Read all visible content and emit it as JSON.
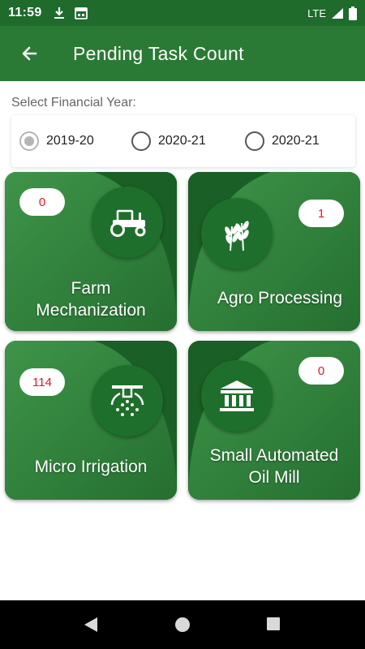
{
  "status_bar": {
    "time": "11:59",
    "network": "LTE",
    "icons": [
      "download-icon",
      "calendar-icon",
      "signal-icon",
      "battery-icon"
    ]
  },
  "app_bar": {
    "title": "Pending Task Count",
    "back_icon": "arrow-left-icon"
  },
  "financial_year": {
    "label": "Select Financial Year:",
    "options": [
      {
        "label": "2019-20",
        "checked": true
      },
      {
        "label": "2020-21",
        "checked": false
      },
      {
        "label": "2020-21",
        "checked": false
      }
    ]
  },
  "tiles": [
    {
      "title_line1": "Farm",
      "title_line2": "Mechanization",
      "count": "0",
      "icon": "tractor-icon"
    },
    {
      "title_line1": "Agro Processing",
      "title_line2": "",
      "count": "1",
      "icon": "wheat-icon"
    },
    {
      "title_line1": "Micro Irrigation",
      "title_line2": "",
      "count": "114",
      "icon": "sprinkler-icon"
    },
    {
      "title_line1": "Small Automated",
      "title_line2": "Oil Mill",
      "count": "0",
      "icon": "building-icon"
    }
  ],
  "colors": {
    "primary": "#2a7a35",
    "status_bar": "#1e6b2b",
    "tile_dark": "#1e6b2b",
    "tile_light": "#3a8f45",
    "badge_text": "#e21b1b"
  },
  "nav_bar": {
    "icons": [
      "back-triangle-icon",
      "home-circle-icon",
      "recents-square-icon"
    ]
  }
}
